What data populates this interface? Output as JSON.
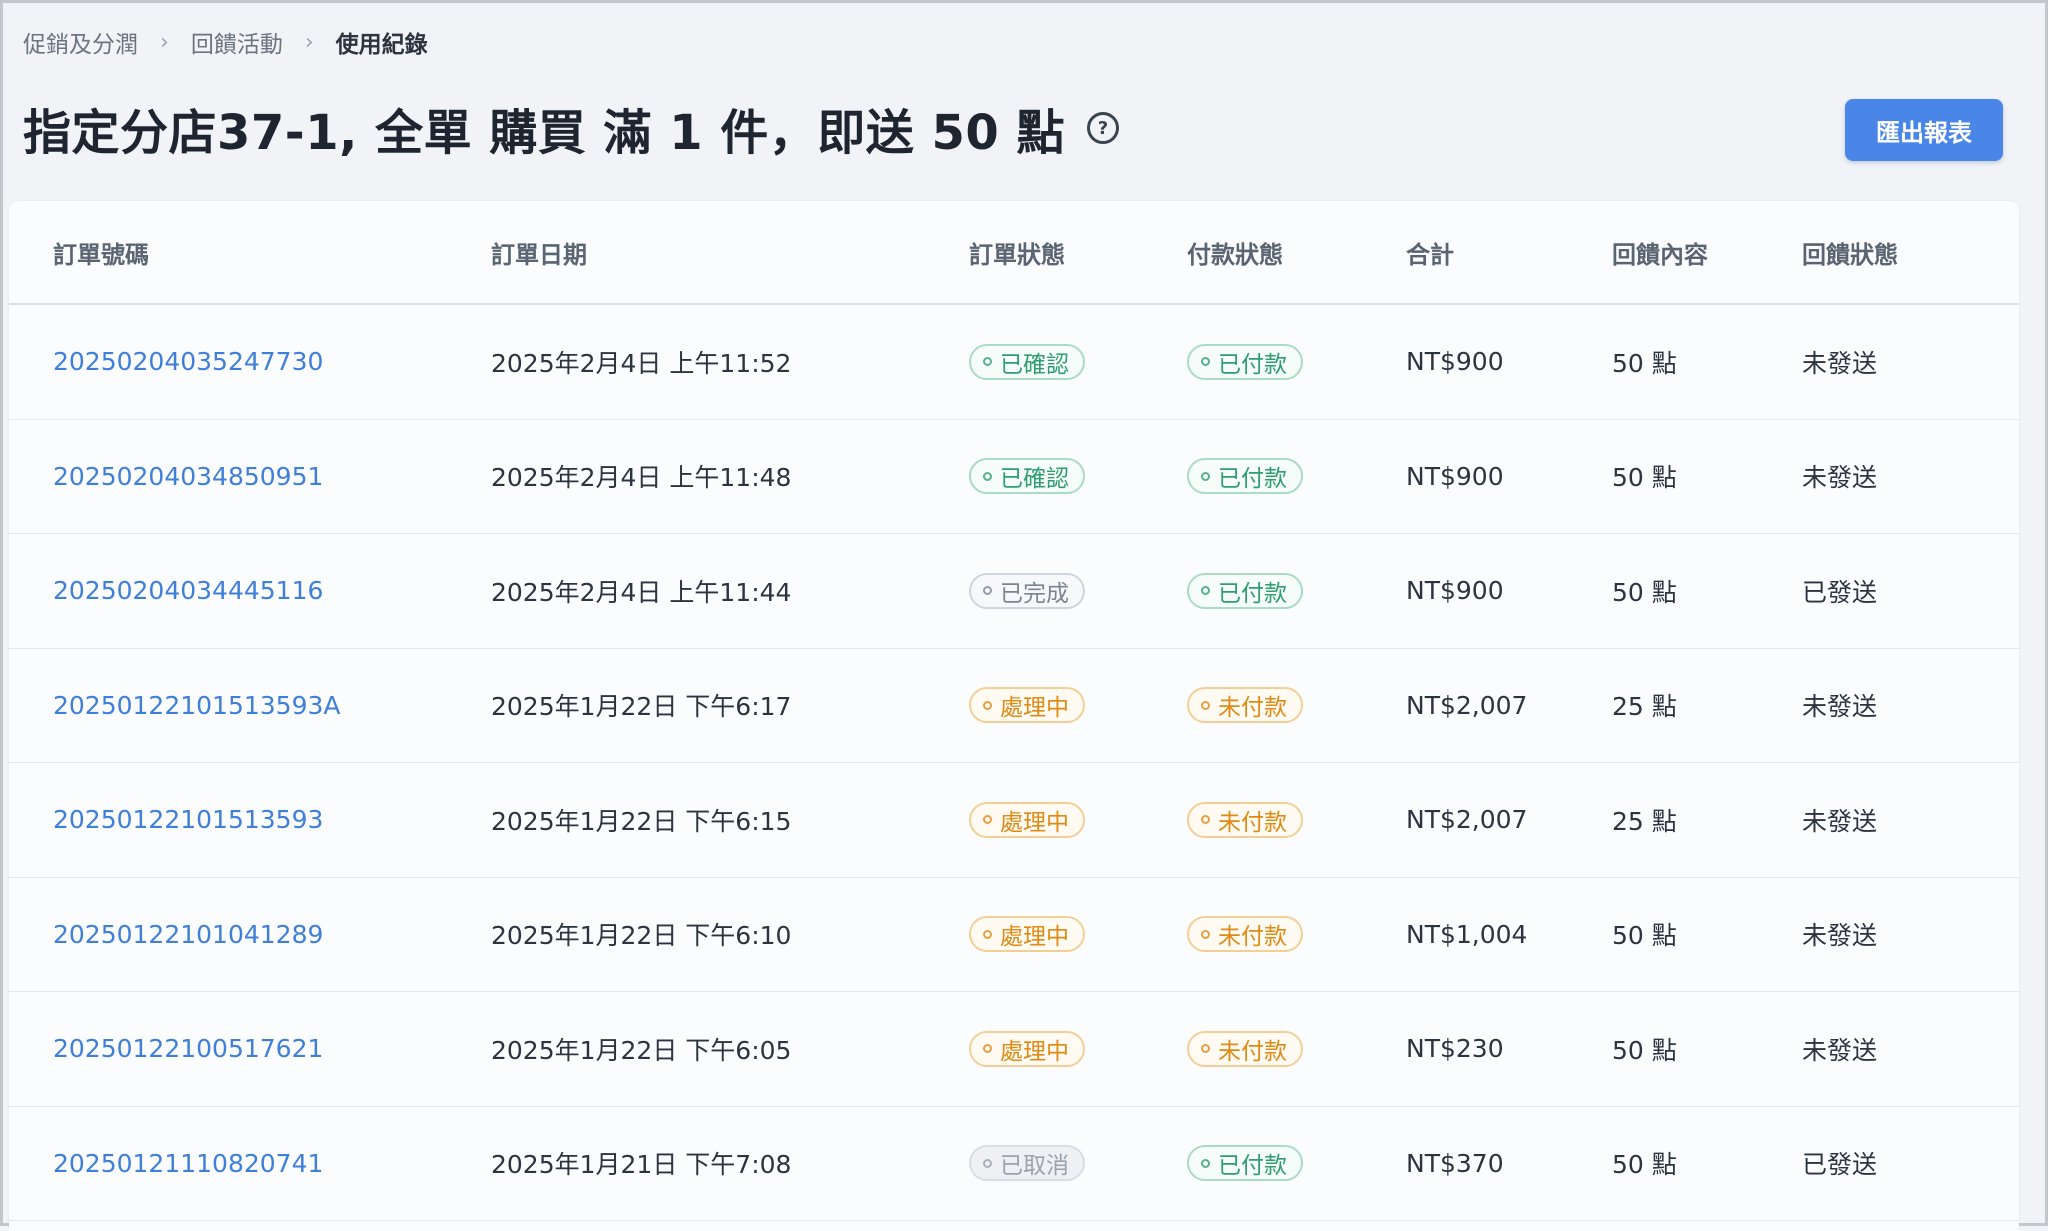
{
  "breadcrumb": [
    "促銷及分潤",
    "回饋活動",
    "使用紀錄"
  ],
  "page": {
    "title": "指定分店37-1, 全單 購買 滿 1 件，即送 50 點",
    "help_icon": "question-circle-icon",
    "export_label": "匯出報表"
  },
  "table": {
    "headers": [
      "訂單號碼",
      "訂單日期",
      "訂單狀態",
      "付款狀態",
      "合計",
      "回饋內容",
      "回饋狀態"
    ],
    "rows": [
      {
        "order": "20250204035247730",
        "date": "2025年2月4日 上午11:52",
        "status": "已確認",
        "status_tone": "green",
        "payment": "已付款",
        "payment_tone": "green",
        "total": "NT$900",
        "reward": "50 點",
        "reward_status": "未發送"
      },
      {
        "order": "20250204034850951",
        "date": "2025年2月4日 上午11:48",
        "status": "已確認",
        "status_tone": "green",
        "payment": "已付款",
        "payment_tone": "green",
        "total": "NT$900",
        "reward": "50 點",
        "reward_status": "未發送"
      },
      {
        "order": "20250204034445116",
        "date": "2025年2月4日 上午11:44",
        "status": "已完成",
        "status_tone": "gray",
        "payment": "已付款",
        "payment_tone": "green",
        "total": "NT$900",
        "reward": "50 點",
        "reward_status": "已發送"
      },
      {
        "order": "20250122101513593A",
        "date": "2025年1月22日 下午6:17",
        "status": "處理中",
        "status_tone": "orange",
        "payment": "未付款",
        "payment_tone": "orange",
        "total": "NT$2,007",
        "reward": "25 點",
        "reward_status": "未發送"
      },
      {
        "order": "20250122101513593",
        "date": "2025年1月22日 下午6:15",
        "status": "處理中",
        "status_tone": "orange",
        "payment": "未付款",
        "payment_tone": "orange",
        "total": "NT$2,007",
        "reward": "25 點",
        "reward_status": "未發送"
      },
      {
        "order": "20250122101041289",
        "date": "2025年1月22日 下午6:10",
        "status": "處理中",
        "status_tone": "orange",
        "payment": "未付款",
        "payment_tone": "orange",
        "total": "NT$1,004",
        "reward": "50 點",
        "reward_status": "未發送"
      },
      {
        "order": "20250122100517621",
        "date": "2025年1月22日 下午6:05",
        "status": "處理中",
        "status_tone": "orange",
        "payment": "未付款",
        "payment_tone": "orange",
        "total": "NT$230",
        "reward": "50 點",
        "reward_status": "未發送"
      },
      {
        "order": "20250121110820741",
        "date": "2025年1月21日 下午7:08",
        "status": "已取消",
        "status_tone": "muted",
        "payment": "已付款",
        "payment_tone": "green",
        "total": "NT$370",
        "reward": "50 點",
        "reward_status": "已發送"
      }
    ]
  }
}
